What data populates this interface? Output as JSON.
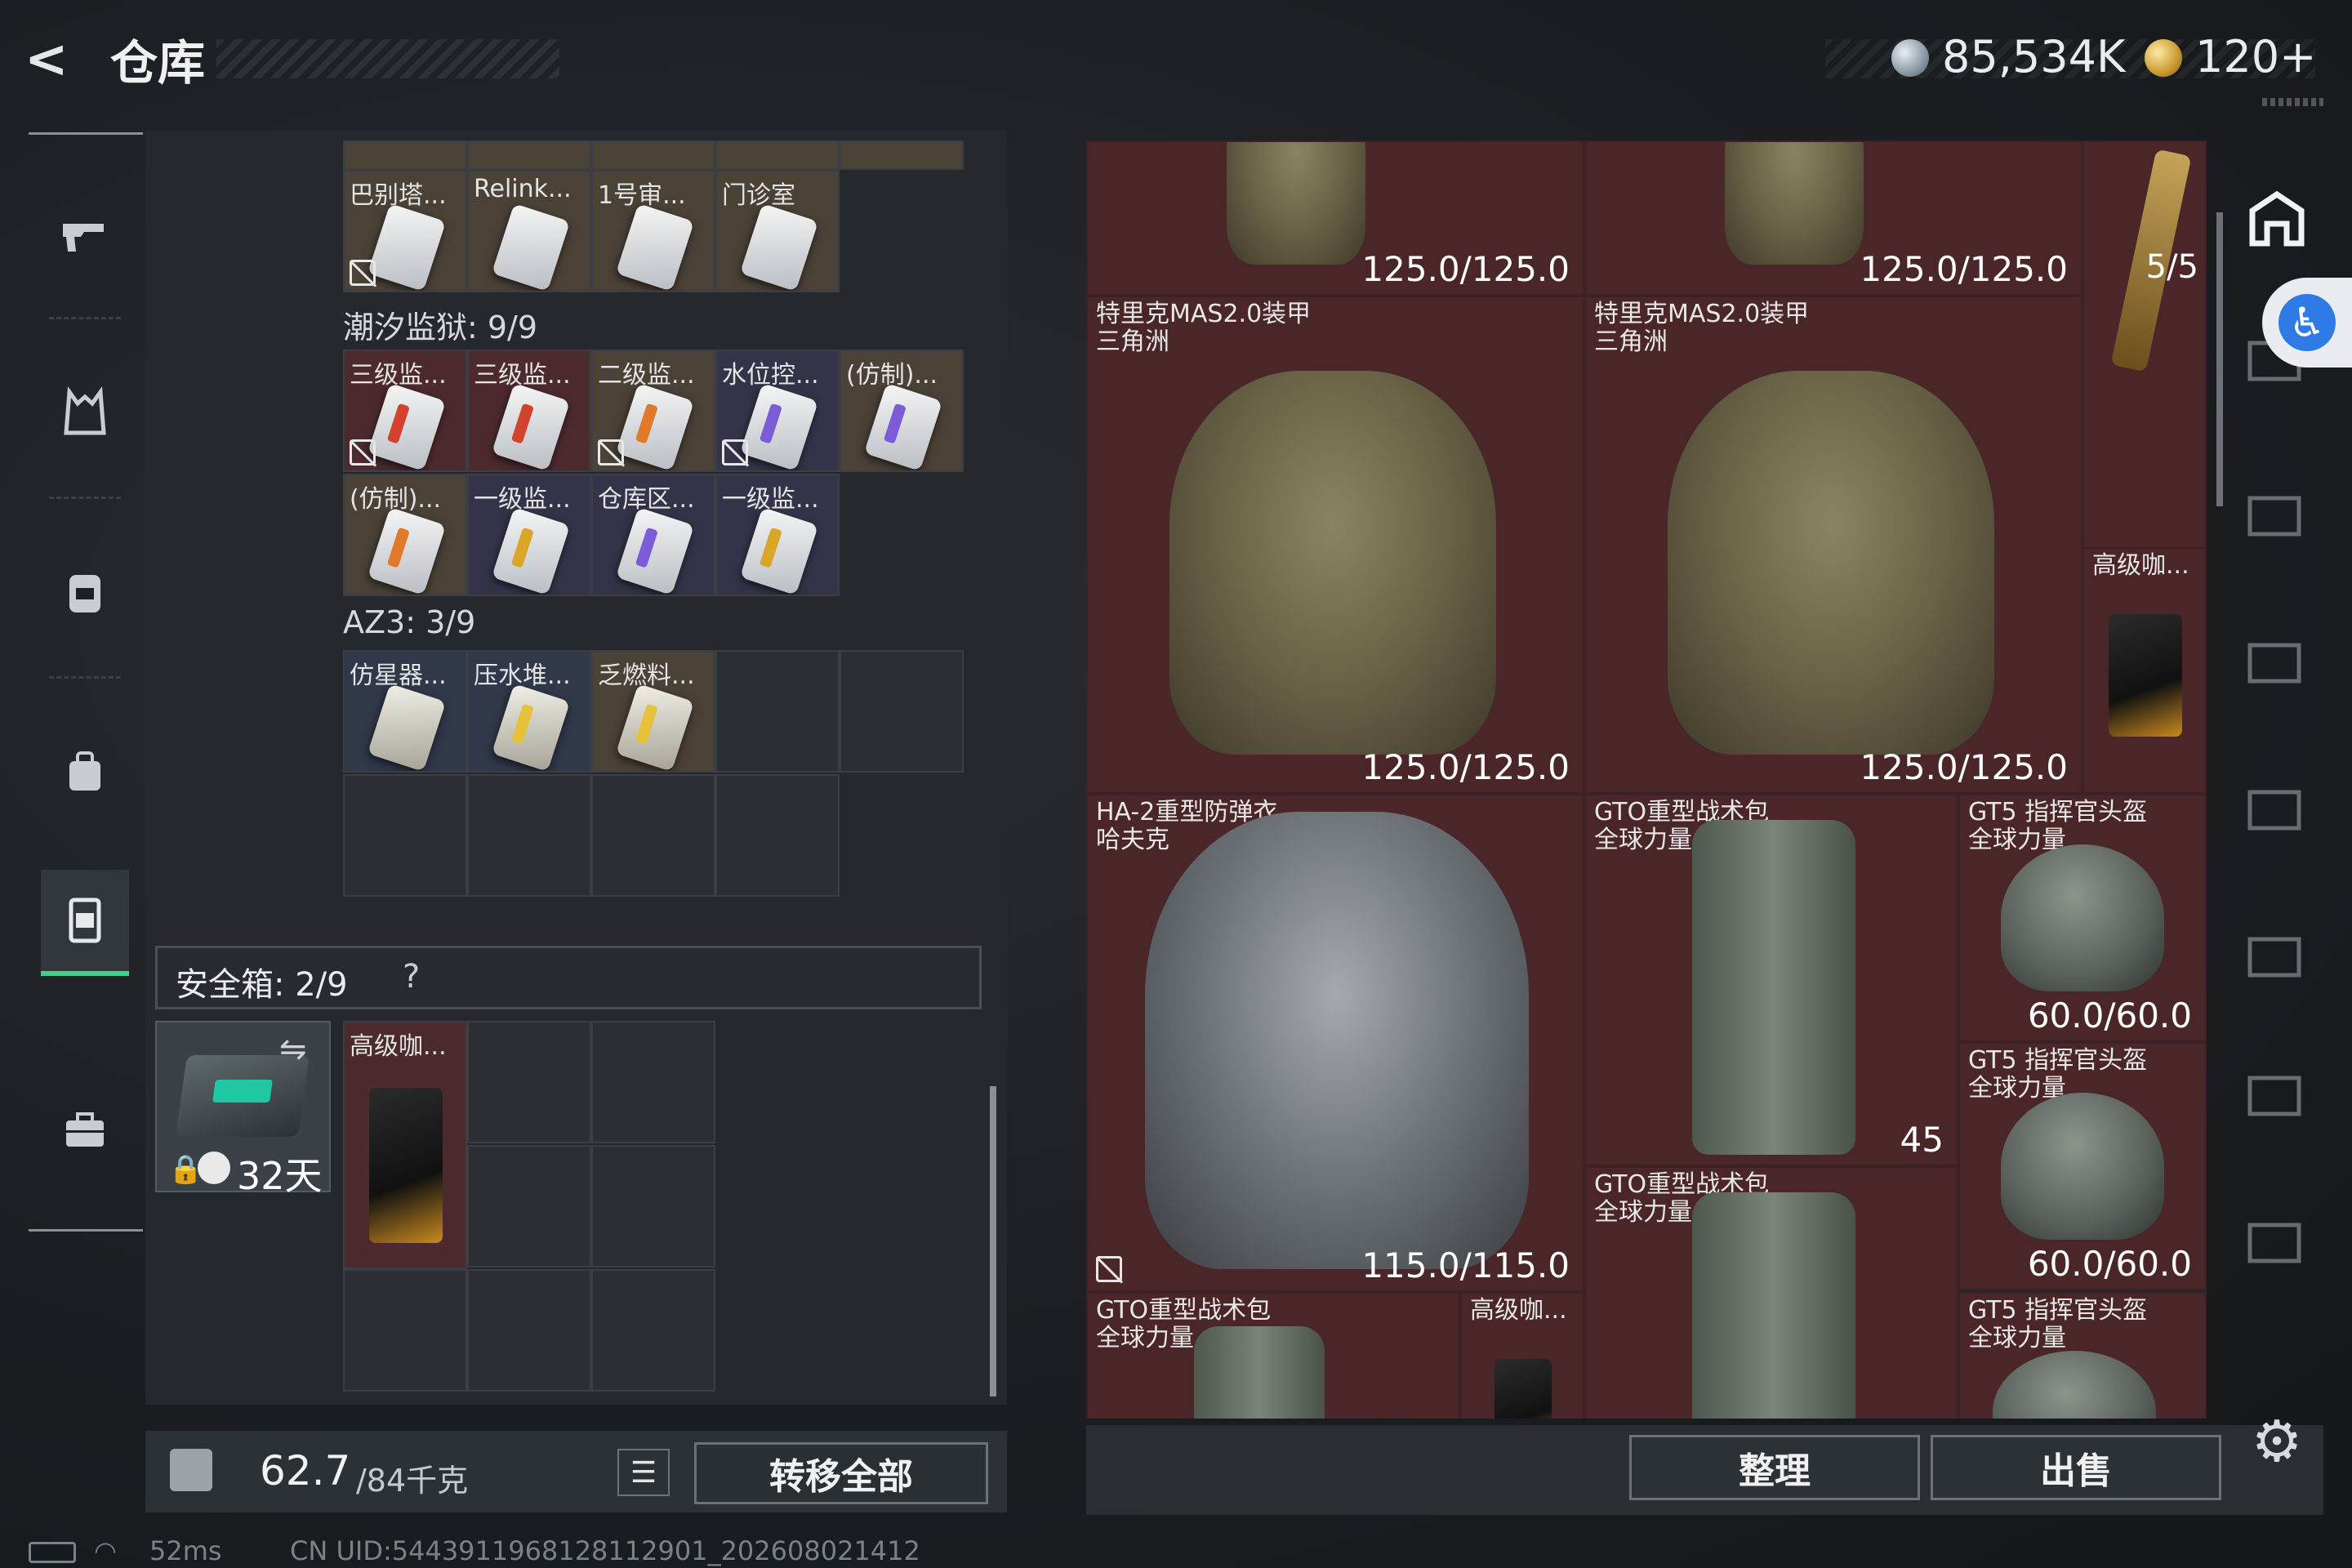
{
  "header": {
    "title": "仓库",
    "currency_primary": "85,534K",
    "currency_secondary": "120+"
  },
  "left_panel": {
    "top_row_items": [
      "巴别塔...",
      "Relink...",
      "1号审...",
      "门诊室"
    ],
    "groups": [
      {
        "label": "潮汐监狱: 9/9",
        "items": [
          "三级监...",
          "三级监...",
          "二级监...",
          "水位控...",
          "(仿制)...",
          "(仿制)...",
          "一级监...",
          "仓库区...",
          "一级监..."
        ]
      },
      {
        "label": "AZ3: 3/9",
        "items": [
          "仿星器...",
          "压水堆...",
          "乏燃料..."
        ]
      }
    ],
    "safe_box": {
      "label": "安全箱: 2/9",
      "help": "?",
      "days": "32天",
      "item": "高级咖..."
    },
    "weight": {
      "current": "62.7",
      "max": "/84千克"
    },
    "transfer_all": "转移全部",
    "list_icon": "list-icon"
  },
  "status_bar": {
    "ping": "52ms",
    "uid": "CN UID:5443911968128112901_202608021412"
  },
  "right_panel": {
    "slots": [
      {
        "id": "top-1",
        "label": "",
        "value": "125.0/125.0"
      },
      {
        "id": "top-2",
        "label": "",
        "value": "125.0/125.0"
      },
      {
        "id": "rifle",
        "label": "",
        "value": "5/5"
      },
      {
        "id": "armor-1",
        "label": "特里克MAS2.0装甲\n三角洲",
        "value": "125.0/125.0"
      },
      {
        "id": "armor-2",
        "label": "特里克MAS2.0装甲\n三角洲",
        "value": "125.0/125.0"
      },
      {
        "id": "coffee-1",
        "label": "高级咖...",
        "value": ""
      },
      {
        "id": "armor-3",
        "label": "HA-2重型防弹衣\n哈夫克",
        "value": "115.0/115.0"
      },
      {
        "id": "pack-1",
        "label": "GTO重型战术包\n全球力量",
        "value": "45"
      },
      {
        "id": "helmet-1",
        "label": "GT5 指挥官头盔\n全球力量",
        "value": "60.0/60.0"
      },
      {
        "id": "helmet-2",
        "label": "GT5 指挥官头盔\n全球力量",
        "value": "60.0/60.0"
      },
      {
        "id": "pack-2",
        "label": "GTO重型战术包\n全球力量",
        "value": ""
      },
      {
        "id": "pack-3",
        "label": "GTO重型战术包\n全球力量",
        "value": ""
      },
      {
        "id": "coffee-2",
        "label": "高级咖...",
        "value": ""
      },
      {
        "id": "helmet-3",
        "label": "GT5 指挥官头盔\n全球力量",
        "value": ""
      }
    ]
  },
  "actions": {
    "sort": "整理",
    "sell": "出售"
  },
  "colors": {
    "accent_green": "#3fd08a",
    "slot_red": "#4a2629",
    "a11y_blue": "#2e7be6"
  }
}
